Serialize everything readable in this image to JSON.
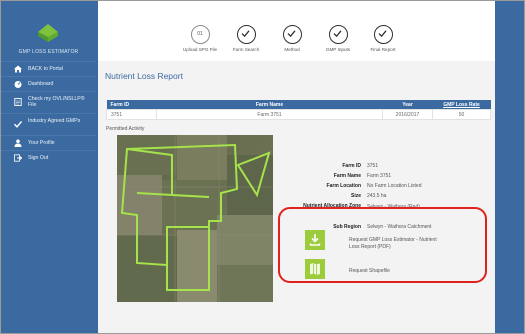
{
  "sidebar": {
    "app_name": "GMP LOSS ESTIMATOR",
    "items": [
      {
        "label": "BACK to Portal",
        "icon": "home-icon"
      },
      {
        "label": "Dashboard",
        "icon": "dashboard-icon"
      },
      {
        "label": "Check my OVL/NSLLP® File",
        "icon": "file-icon"
      },
      {
        "label": "Industry Agreed GMPs",
        "icon": "check-icon"
      },
      {
        "label": "Your Profile",
        "icon": "user-icon"
      },
      {
        "label": "Sign Out",
        "icon": "sign-out-icon"
      }
    ]
  },
  "stepper": {
    "steps": [
      {
        "label": "Upload SPG File",
        "state": "current",
        "number": "01"
      },
      {
        "label": "Farm Search",
        "state": "done"
      },
      {
        "label": "Method",
        "state": "done"
      },
      {
        "label": "GMP Inputs",
        "state": "done"
      },
      {
        "label": "Final Report",
        "state": "done"
      }
    ]
  },
  "page_title": "Nutrient Loss Report",
  "farm_table": {
    "headers": [
      "Farm ID",
      "Farm Name",
      "Year",
      "GMP Loss Rate"
    ],
    "row": [
      "3751",
      "Farm 3751",
      "2016/2017",
      "50"
    ]
  },
  "permitted_activity_label": "Permitted Activity",
  "details": [
    {
      "key": "Farm ID",
      "value": "3751"
    },
    {
      "key": "Farm Name",
      "value": "Farm 3751"
    },
    {
      "key": "Farm Location",
      "value": "No Farm Location Listed"
    },
    {
      "key": "Size",
      "value": "243.5 ha"
    },
    {
      "key": "Nutrient Allocation Zone",
      "value": "Selwyn - Waihora (Red)"
    },
    {
      "key": "Sub Region",
      "value": "Selwyn - Waihora Catchment"
    }
  ],
  "actions": {
    "download_report": "Request GMP Loss Estimator - Nutrient Loss Report (PDF)",
    "request_shapefile": "Request Shapefile"
  },
  "colors": {
    "brand_blue": "#3b6aa1",
    "accent_green": "#9ccb3b",
    "highlight_red": "#e0211d"
  }
}
